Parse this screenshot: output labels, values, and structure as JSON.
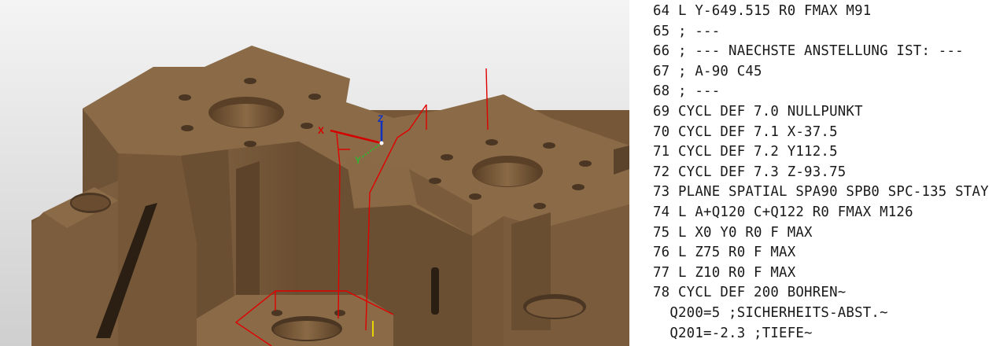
{
  "viewport": {
    "axis_labels": {
      "x": "X",
      "y": "Y",
      "z": "Z"
    },
    "colors": {
      "part_top": "#8b6b47",
      "part_side": "#6e5234",
      "part_dark": "#4a3622",
      "background": "#d9d9d9",
      "toolpath": "#e00000",
      "axis_x": "#d40000",
      "axis_y": "#2fb52f",
      "axis_z": "#1030c0",
      "tool_marker": "#e6d400"
    }
  },
  "program": {
    "lines": [
      "64 L Y-649.515 R0 FMAX M91",
      "65 ; ---",
      "66 ; --- NAECHSTE ANSTELLUNG IST: ---",
      "67 ; A-90 C45",
      "68 ; ---",
      "69 CYCL DEF 7.0 NULLPUNKT",
      "70 CYCL DEF 7.1 X-37.5",
      "71 CYCL DEF 7.2 Y112.5",
      "72 CYCL DEF 7.3 Z-93.75",
      "73 PLANE SPATIAL SPA90 SPB0 SPC-135 STAY",
      "74 L A+Q120 C+Q122 R0 FMAX M126",
      "75 L X0 Y0 R0 F MAX",
      "76 L Z75 R0 F MAX",
      "77 L Z10 R0 F MAX",
      "78 CYCL DEF 200 BOHREN~",
      "  Q200=5 ;SICHERHEITS-ABST.~",
      "  Q201=-2.3 ;TIEFE~"
    ]
  }
}
